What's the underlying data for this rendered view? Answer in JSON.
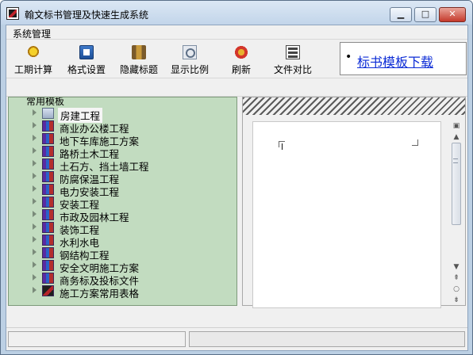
{
  "window": {
    "title": "翰文标书管理及快速生成系统"
  },
  "menu": {
    "items": [
      {
        "label": "系统管理"
      }
    ]
  },
  "toolbar": {
    "buttons": [
      {
        "label": "工期计算",
        "icon": "calendar-calc-icon"
      },
      {
        "label": "格式设置",
        "icon": "format-settings-icon"
      },
      {
        "label": "隐藏标题",
        "icon": "hide-title-icon"
      },
      {
        "label": "显示比例",
        "icon": "zoom-ratio-icon"
      },
      {
        "label": "刷新",
        "icon": "refresh-icon"
      },
      {
        "label": "文件对比",
        "icon": "file-compare-icon"
      }
    ]
  },
  "link_panel": {
    "link_text": "标书模板下载"
  },
  "tree": {
    "root_label": "常用模板",
    "items": [
      {
        "label": "房建工程"
      },
      {
        "label": "商业办公楼工程"
      },
      {
        "label": "地下车库施工方案"
      },
      {
        "label": "路桥土木工程"
      },
      {
        "label": "土石方、挡土墙工程"
      },
      {
        "label": "防腐保温工程"
      },
      {
        "label": "电力安装工程"
      },
      {
        "label": "安装工程"
      },
      {
        "label": "市政及园林工程"
      },
      {
        "label": "装饰工程"
      },
      {
        "label": "水利水电"
      },
      {
        "label": "钢结构工程"
      },
      {
        "label": "安全文明施工方案"
      },
      {
        "label": "商务标及投标文件"
      },
      {
        "label": "施工方案常用表格"
      }
    ],
    "selected_index": 0
  },
  "colors": {
    "tree_background": "#c2dcc0",
    "link": "#0b2bd6",
    "title_bar": "#c2d5ea"
  }
}
